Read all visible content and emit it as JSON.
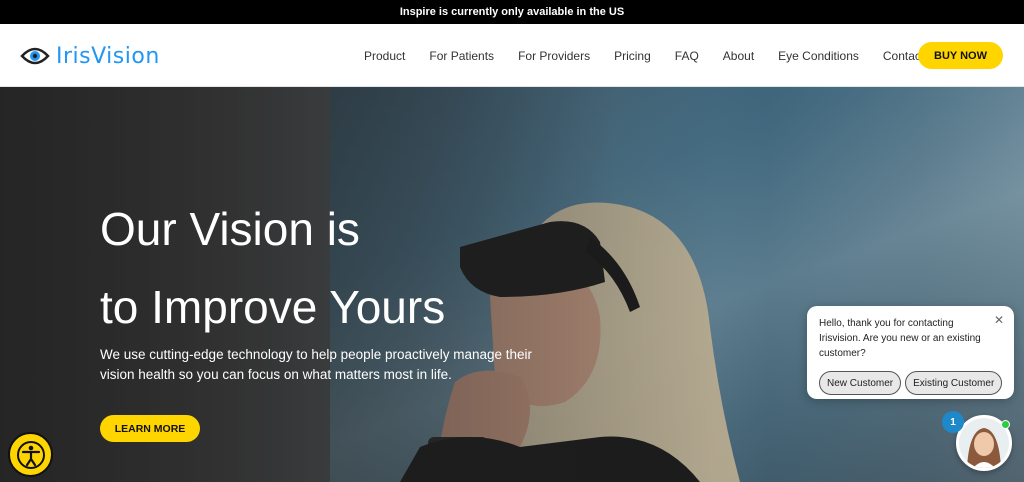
{
  "topbar": {
    "notice": "Inspire is currently only available in the US"
  },
  "logo": {
    "text": "IrisVision"
  },
  "nav": {
    "items": [
      "Product",
      "For Patients",
      "For Providers",
      "Pricing",
      "FAQ",
      "About",
      "Eye Conditions",
      "Contact Us"
    ],
    "buy_label": "BUY NOW"
  },
  "hero": {
    "headline_line1": "Our Vision is",
    "headline_line2": "to Improve Yours",
    "subtext": "We use cutting-edge technology to help people proactively manage their vision health so you can focus on what matters most in life.",
    "cta_label": "LEARN MORE"
  },
  "chat": {
    "message": "Hello, thank you for contacting Irisvision. Are you new or an existing customer?",
    "btn_new": "New Customer",
    "btn_existing": "Existing Customer",
    "badge_count": "1"
  },
  "colors": {
    "accent_yellow": "#ffd500",
    "brand_blue": "#2196f3"
  },
  "icons": [
    "eye-logo-icon",
    "accessibility-icon",
    "close-icon"
  ]
}
